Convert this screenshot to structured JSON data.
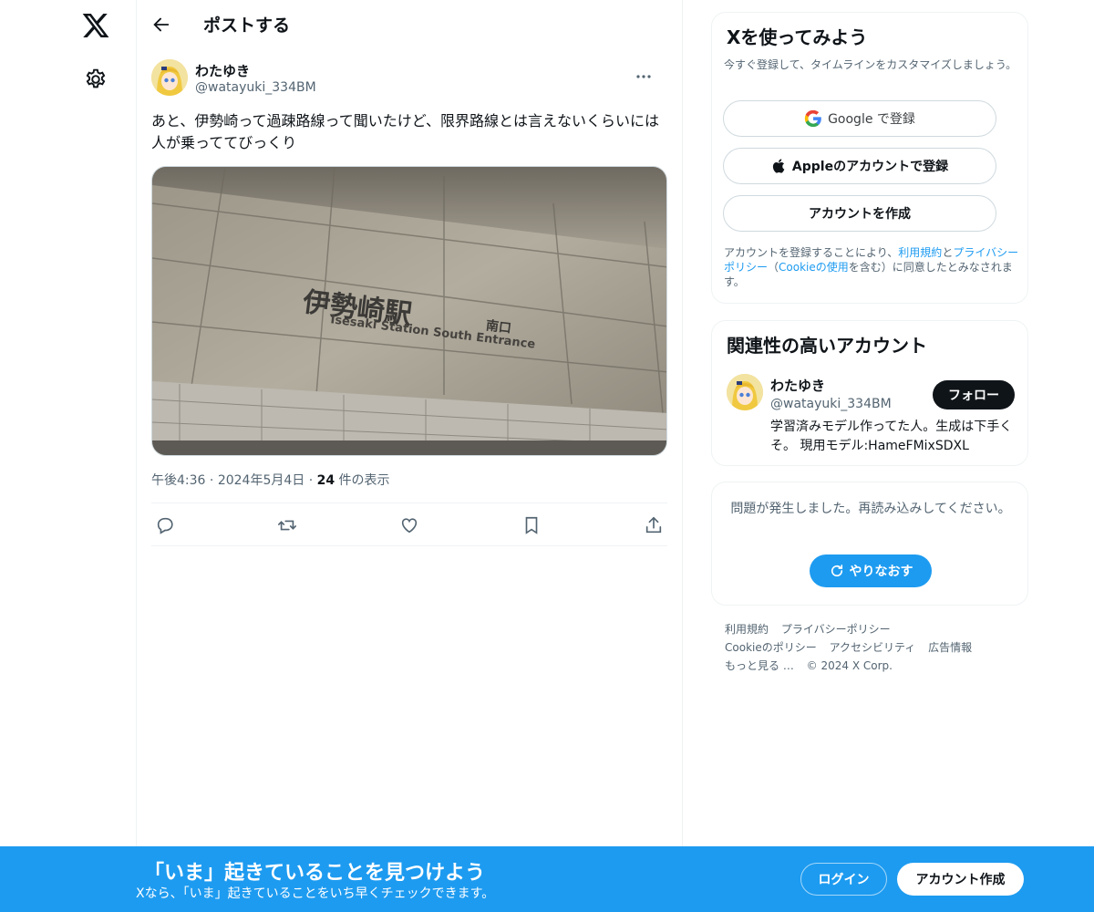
{
  "header": {
    "title": "ポストする"
  },
  "post": {
    "author_name": "わたゆき",
    "author_handle": "@watayuki_334BM",
    "text": "あと、伊勢崎って過疎路線って聞いたけど、限界路線とは言えないくらいには人が乗っててびっくり",
    "photo_sign_jp": "伊勢崎駅",
    "photo_sign_jp_small": "南口",
    "photo_sign_en": "Isesaki Station South Entrance",
    "time": "午後4:36",
    "sep1": "·",
    "date": "2024年5月4日",
    "sep2": "·",
    "views_count": "24",
    "views_label": " 件の表示"
  },
  "signup_card": {
    "title": "Xを使ってみよう",
    "subtitle": "今すぐ登録して、タイムラインをカスタマイズしましょう。",
    "google_label": "Google で登録",
    "apple_label": "Appleのアカウントで登録",
    "create_label": "アカウントを作成",
    "terms_prefix": "アカウントを登録することにより、",
    "terms_link1": "利用規約",
    "terms_and": "と",
    "terms_link2": "プライバシーポリシー",
    "terms_paren_open": "（",
    "terms_link3": "Cookieの使用",
    "terms_suffix": "を含む）に同意したとみなされます。"
  },
  "related": {
    "title": "関連性の高いアカウント",
    "name": "わたゆき",
    "handle": "@watayuki_334BM",
    "follow_label": "フォロー",
    "bio": "学習済みモデル作ってた人。生成は下手くそ。 現用モデル:HameFMixSDXL"
  },
  "error_card": {
    "message": "問題が発生しました。再読み込みしてください。",
    "retry_label": "やりなおす"
  },
  "footer": {
    "links": [
      "利用規約",
      "プライバシーポリシー",
      "Cookieのポリシー",
      "アクセシビリティ",
      "広告情報",
      "もっと見る …"
    ],
    "copyright": "© 2024 X Corp."
  },
  "banner": {
    "title": "「いま」起きていることを見つけよう",
    "subtitle": "Xなら、「いま」起きていることをいち早くチェックできます。",
    "login_label": "ログイン",
    "signup_label": "アカウント作成"
  },
  "colors": {
    "accent": "#1d9bf0",
    "text_primary": "#0f1419",
    "text_secondary": "#536471"
  },
  "icons": [
    "x-logo-icon",
    "gear-icon",
    "back-arrow-icon",
    "more-icon",
    "reply-icon",
    "repost-icon",
    "like-icon",
    "bookmark-icon",
    "share-icon",
    "google-icon",
    "apple-icon",
    "refresh-icon"
  ]
}
